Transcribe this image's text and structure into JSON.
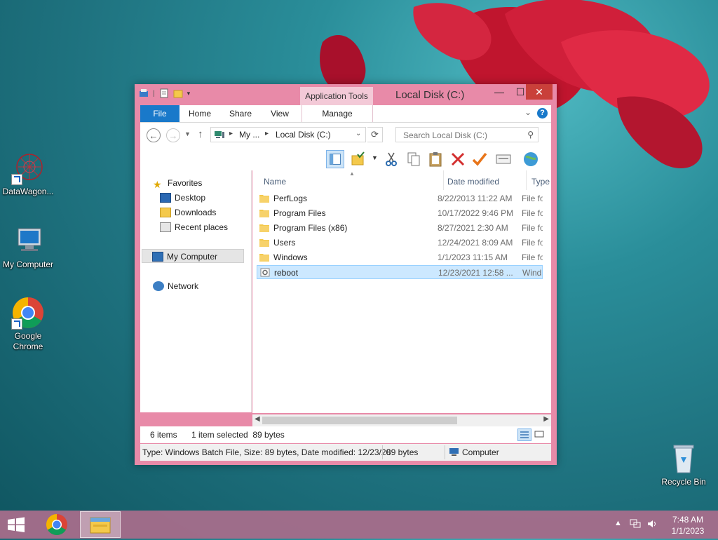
{
  "desktop": {
    "icons": [
      {
        "label": "DataWagon..."
      },
      {
        "label": "My Computer"
      },
      {
        "label": "Google Chrome"
      },
      {
        "label": "Recycle Bin"
      }
    ]
  },
  "window": {
    "title": "Local Disk (C:)",
    "context_tab_group": "Application Tools",
    "controls": {
      "minimize": "—",
      "maximize": "☐",
      "close": "✕"
    },
    "ribbon_tabs": {
      "file": "File",
      "home": "Home",
      "share": "Share",
      "view": "View",
      "manage": "Manage"
    },
    "address": {
      "crumbs": [
        "My ...",
        "Local Disk (C:)"
      ],
      "search_placeholder": "Search Local Disk (C:)"
    },
    "nav_pane": {
      "favorites": "Favorites",
      "desktop": "Desktop",
      "downloads": "Downloads",
      "recent": "Recent places",
      "my_computer": "My Computer",
      "network": "Network"
    },
    "columns": {
      "name": "Name",
      "date": "Date modified",
      "type": "Type"
    },
    "files": [
      {
        "name": "PerfLogs",
        "date": "8/22/2013 11:22 AM",
        "type": "File fo",
        "kind": "folder"
      },
      {
        "name": "Program Files",
        "date": "10/17/2022 9:46 PM",
        "type": "File fo",
        "kind": "folder"
      },
      {
        "name": "Program Files (x86)",
        "date": "8/27/2021 2:30 AM",
        "type": "File fo",
        "kind": "folder"
      },
      {
        "name": "Users",
        "date": "12/24/2021 8:09 AM",
        "type": "File fo",
        "kind": "folder"
      },
      {
        "name": "Windows",
        "date": "1/1/2023 11:15 AM",
        "type": "File fo",
        "kind": "folder"
      },
      {
        "name": "reboot",
        "date": "12/23/2021 12:58 ...",
        "type": "Wind",
        "kind": "batch",
        "selected": true
      }
    ],
    "status": {
      "count": "6 items",
      "selection": "1 item selected  89 bytes"
    },
    "details": {
      "info": "Type: Windows Batch File, Size: 89 bytes, Date modified: 12/23/20",
      "size": "89 bytes",
      "location": "Computer"
    }
  },
  "taskbar": {
    "time": "7:48 AM",
    "date": "1/1/2023"
  },
  "colors": {
    "window_frame": "#e88aa8",
    "accent_blue": "#1979ca",
    "selection": "#cce8ff",
    "close_red": "#c9403a"
  }
}
